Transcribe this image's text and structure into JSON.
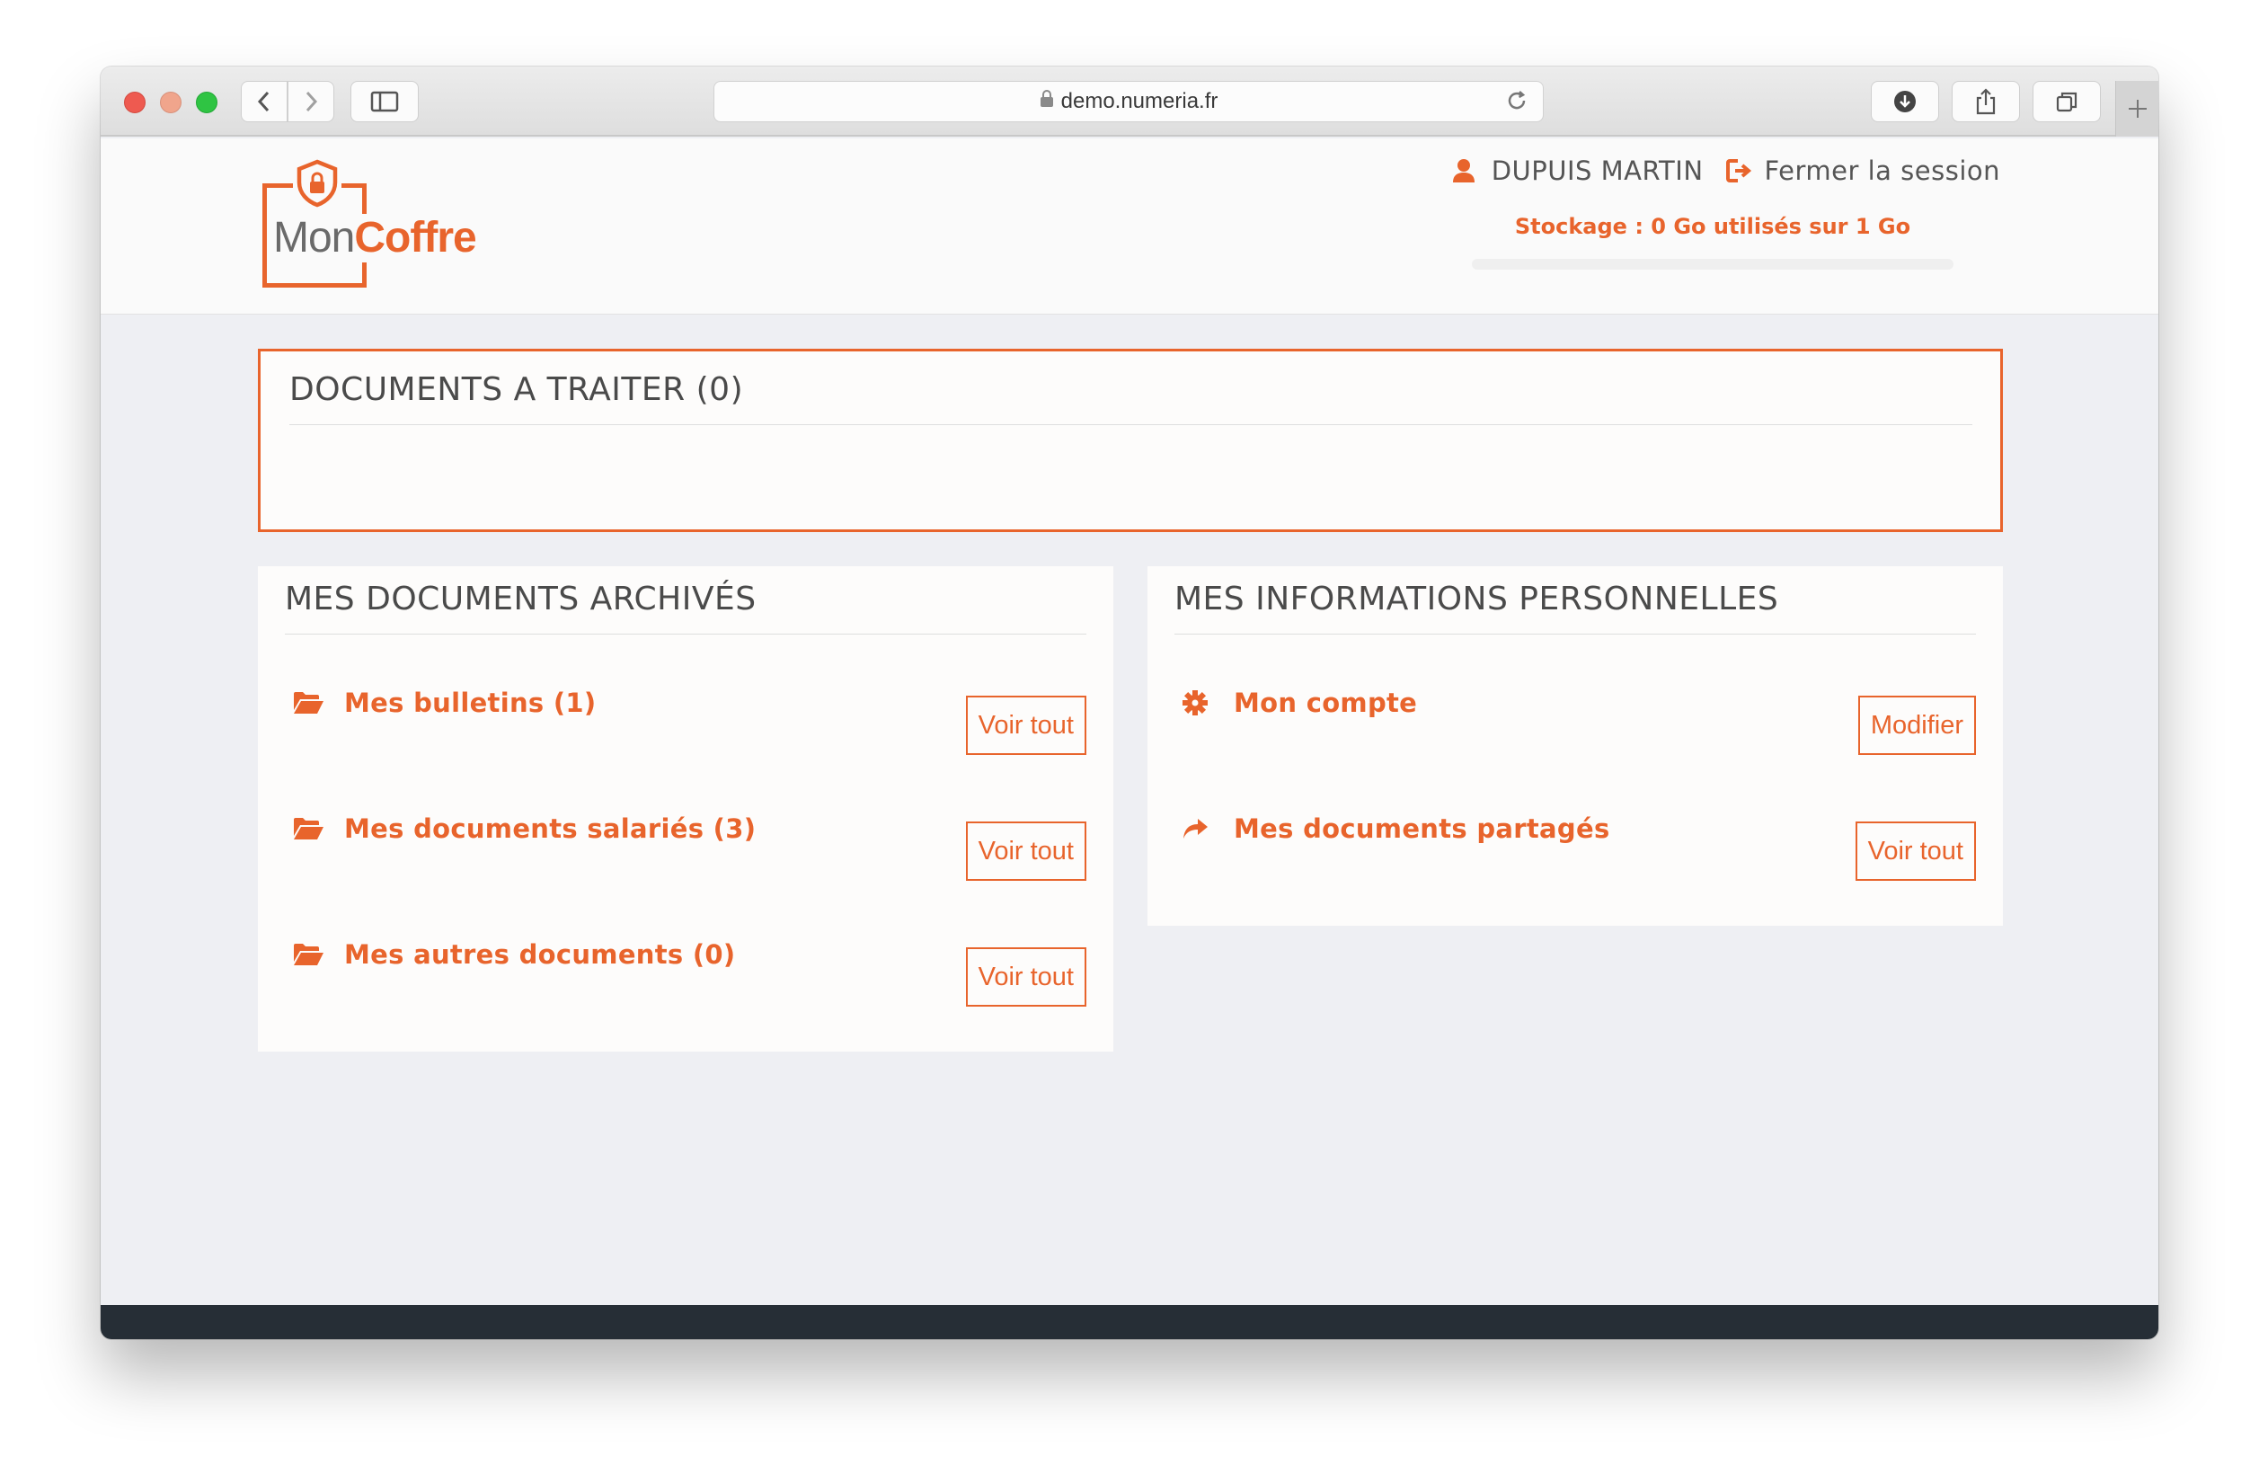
{
  "browser": {
    "url": "demo.numeria.fr"
  },
  "header": {
    "logo": {
      "mon": "Mon",
      "coffre": "Coffre"
    },
    "user_name": "DUPUIS MARTIN",
    "logout_label": "Fermer la session",
    "storage_text": "Stockage : 0 Go utilisés sur 1 Go",
    "storage_used_fraction": 0
  },
  "todo": {
    "title": "DOCUMENTS A TRAITER (0)"
  },
  "archived": {
    "title": "MES DOCUMENTS ARCHIVÉS",
    "items": [
      {
        "icon": "folder-open-icon",
        "label": "Mes bulletins (1)",
        "action": "Voir tout"
      },
      {
        "icon": "folder-open-icon",
        "label": "Mes documents salariés (3)",
        "action": "Voir tout"
      },
      {
        "icon": "folder-open-icon",
        "label": "Mes autres documents (0)",
        "action": "Voir tout"
      }
    ]
  },
  "personal": {
    "title": "MES INFORMATIONS PERSONNELLES",
    "items": [
      {
        "icon": "gear-icon",
        "label": "Mon compte",
        "action": "Modifier"
      },
      {
        "icon": "share-arrow-icon",
        "label": "Mes documents partagés",
        "action": "Voir tout"
      }
    ]
  },
  "colors": {
    "accent": "#e8642c",
    "page_bg": "#eeeff3",
    "footer": "#262e36"
  }
}
